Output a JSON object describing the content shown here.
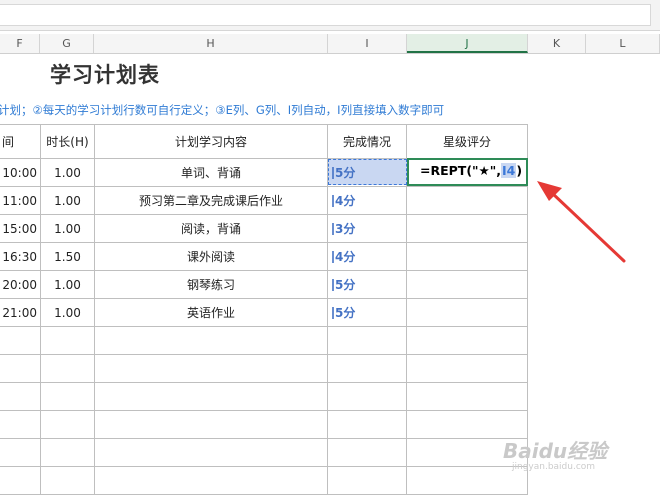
{
  "columns": [
    "F",
    "G",
    "H",
    "I",
    "J",
    "K",
    "L"
  ],
  "title": "学习计划表",
  "note": "计划；②每天的学习计划行数可自行定义；③E列、G列、I列自动，I列直接填入数字即可",
  "headers": {
    "time": "间",
    "duration": "时长(H)",
    "content": "计划学习内容",
    "status": "完成情况",
    "rating": "星级评分"
  },
  "rows": [
    {
      "time": "10:00",
      "duration": "1.00",
      "content": "单词、背诵",
      "status": "5分"
    },
    {
      "time": "11:00",
      "duration": "1.00",
      "content": "预习第二章及完成课后作业",
      "status": "4分"
    },
    {
      "time": "15:00",
      "duration": "1.00",
      "content": "阅读，背诵",
      "status": "3分"
    },
    {
      "time": "16:30",
      "duration": "1.50",
      "content": "课外阅读",
      "status": "4分"
    },
    {
      "time": "20:00",
      "duration": "1.00",
      "content": "钢琴练习",
      "status": "5分"
    },
    {
      "time": "21:00",
      "duration": "1.00",
      "content": "英语作业",
      "status": "5分"
    }
  ],
  "formula": {
    "prefix": "=REPT(\"★\",",
    "ref": "I4",
    "suffix": ")"
  },
  "watermark": {
    "main": "Baidu经验",
    "sub": "jingyan.baidu.com"
  }
}
